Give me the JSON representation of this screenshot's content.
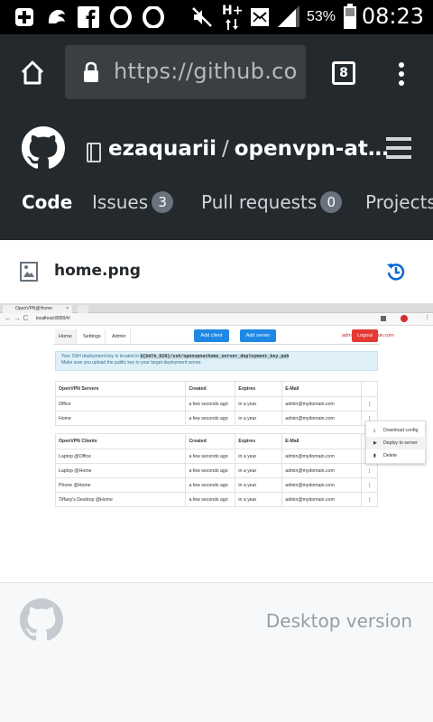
{
  "status_bar": {
    "battery_percent": "53%",
    "time": "08:23",
    "network_label": "H+",
    "icons": [
      "plus-box-icon",
      "uc-browser-icon",
      "facebook-icon",
      "opera-icon",
      "opera-icon",
      "mute-icon",
      "network-type-icon",
      "message-icon",
      "signal-icon",
      "battery-icon"
    ]
  },
  "browser": {
    "url": "https://github.com/",
    "tab_count": "8",
    "icons": [
      "home-icon",
      "lock-icon",
      "tabs-icon",
      "overflow-menu-icon"
    ]
  },
  "repo": {
    "owner": "ezaquarii",
    "separator": "/",
    "name": "openvpn-at…"
  },
  "repo_tabs": [
    {
      "label": "Code",
      "active": true
    },
    {
      "label": "Issues",
      "count": "3"
    },
    {
      "label": "Pull requests",
      "count": "0"
    },
    {
      "label": "Projects"
    }
  ],
  "file": {
    "name": "home.png",
    "icons": [
      "image-file-icon",
      "history-icon"
    ]
  },
  "screenshot": {
    "tab_title": "OpenVPN@Home",
    "url": "localhost:8000/#/",
    "nav": {
      "home": "Home",
      "settings": "Settings",
      "admin": "Admin"
    },
    "buttons": {
      "add_client": "Add client",
      "add_server": "Add server",
      "logout": "Logout"
    },
    "user_email": "admin@mydomain.com",
    "alert": {
      "line1_prefix": "Your SSH deployment key is located in",
      "line1_code": "${DATA_DIR}/ssh/openvpnathome_server_deployment_key.pub",
      "line2": "Make sure you upload the public key to your target deployment server."
    },
    "servers_table": {
      "headers": [
        "OpenVPN Servers",
        "Created",
        "Expires",
        "E-Mail"
      ],
      "rows": [
        [
          "Office",
          "a few seconds ago",
          "in a year",
          "admin@mydomain.com"
        ],
        [
          "Home",
          "a few seconds ago",
          "in a year",
          "admin@mydomain.com"
        ]
      ]
    },
    "clients_table": {
      "headers": [
        "OpenVPN Clients",
        "Created",
        "Expires",
        "E-Mail"
      ],
      "rows": [
        [
          "Laptop @Office",
          "a few seconds ago",
          "in a year",
          "admin@mydomain.com"
        ],
        [
          "Laptop @Home",
          "a few seconds ago",
          "in a year",
          "admin@mydomain.com"
        ],
        [
          "Phone @Home",
          "a few seconds ago",
          "in a year",
          "admin@mydomain.com"
        ],
        [
          "Tiffany's Desktop @Home",
          "a few seconds ago",
          "in a year",
          "admin@mydomain.com"
        ]
      ]
    },
    "context_menu": [
      "Download config",
      "Deploy to server",
      "Delete"
    ],
    "colors": {
      "add_button": "#1e88e5",
      "logout_button": "#e53935",
      "alert_bg": "#dff0f8"
    }
  },
  "footer": {
    "desktop_version": "Desktop version"
  },
  "colors": {
    "header_bg": "#24292e",
    "link_blue": "#0366d6",
    "counter_bg": "#6a737d"
  }
}
